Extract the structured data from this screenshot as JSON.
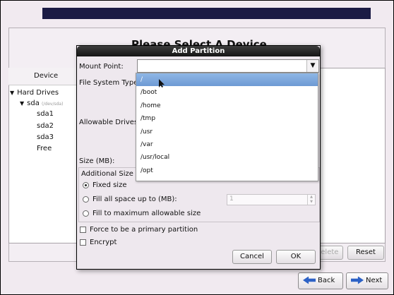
{
  "background": {
    "title": "Please Select A Device",
    "device_column_header": "Device",
    "tree": {
      "hard_drives": "Hard Drives",
      "disk_name": "sda",
      "disk_path": "(/dev/sda)",
      "partitions": [
        "sda1",
        "sda2",
        "sda3",
        "Free"
      ]
    },
    "buttons": {
      "delete": "Delete",
      "reset": "Reset",
      "back": "Back",
      "next": "Next"
    }
  },
  "dialog": {
    "title": "Add Partition",
    "labels": {
      "mount_point": "Mount Point:",
      "file_system_type": "File System Type:",
      "allowable_drives": "Allowable Drives:",
      "size": "Size (MB):",
      "additional_size_options": "Additional Size Options"
    },
    "mount_point_value": "",
    "size_options": {
      "fixed": "Fixed size",
      "fill_up_to": "Fill all space up to (MB):",
      "fill_max": "Fill to maximum allowable size",
      "selected": "fixed"
    },
    "fill_up_to_value": "1",
    "checkboxes": {
      "primary": "Force to be a primary partition",
      "encrypt": "Encrypt"
    },
    "buttons": {
      "cancel": "Cancel",
      "ok": "OK"
    }
  },
  "dropdown": {
    "selected_index": 0,
    "options": [
      "/",
      "/boot",
      "/home",
      "/tmp",
      "/usr",
      "/var",
      "/usr/local",
      "/opt"
    ]
  },
  "colors": {
    "banner": "#1b1b44",
    "selection": "#7fa8dd",
    "nav_arrow": "#2d62c6"
  }
}
